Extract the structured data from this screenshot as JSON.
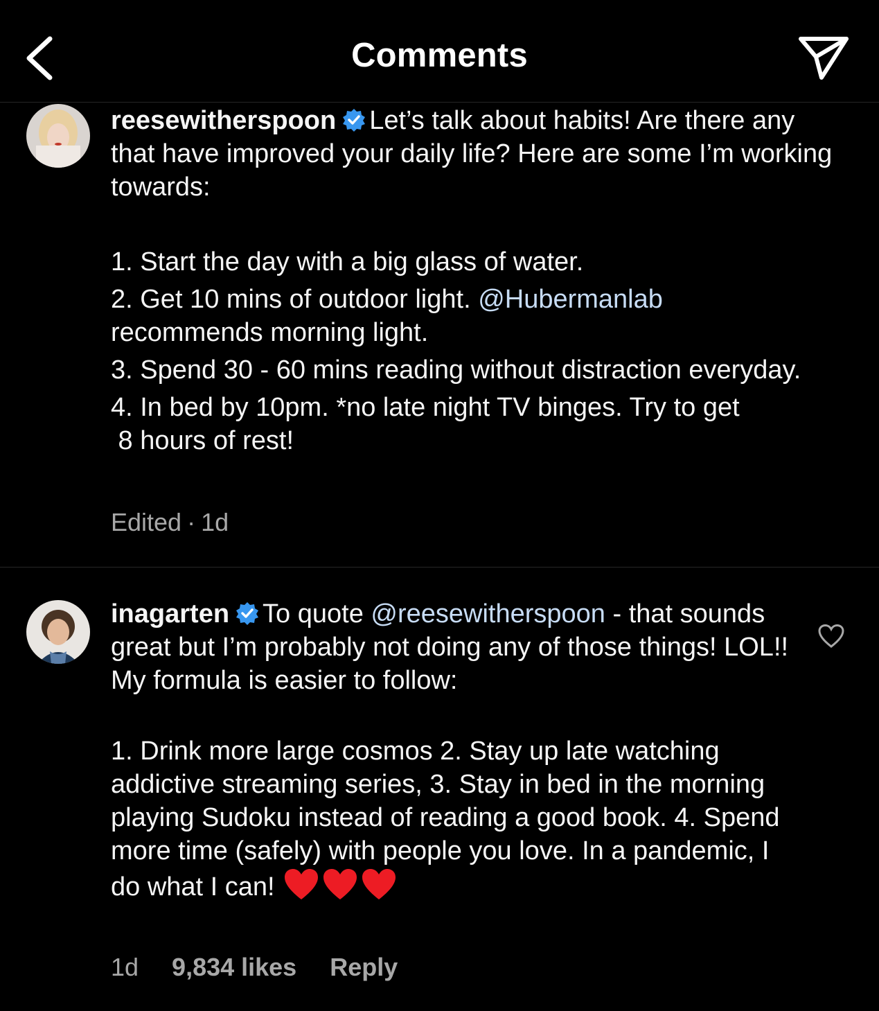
{
  "header": {
    "title": "Comments",
    "back_icon": "chevron-left-icon",
    "share_icon": "paper-plane-icon"
  },
  "comments": [
    {
      "username": "reesewitherspoon",
      "verified": true,
      "text_intro": "Let’s talk about habits! Are there any that have improved your daily life? Here are some I’m working towards:",
      "items": [
        "1. Start the day with a big glass of water.",
        "2. Get 10 mins of outdoor light.",
        "recommends morning light.",
        "3. Spend 30 - 60 mins reading without distraction everyday.",
        "4. In bed by 10pm. *no late night TV binges. Try to get",
        " 8 hours of rest!"
      ],
      "mention": "@Hubermanlab",
      "meta_edited": "Edited",
      "meta_time": "1d"
    },
    {
      "username": "inagarten",
      "verified": true,
      "mention": "@reesewitherspoon",
      "text_pre": "To quote",
      "text_after_mention": "- that sounds great but I’m probably not doing any of those things!  LOL!! My formula is easier to follow:",
      "text_list": "1. Drink more large cosmos  2.  Stay up late watching addictive streaming series,  3.  Stay in bed in the morning playing Sudoku instead of reading a good book.  4.  Spend more time (safely) with people you love.  In a pandemic, I do what I can!",
      "emoji_count": 3,
      "meta_time": "1d",
      "meta_likes": "9,834 likes",
      "meta_reply": "Reply",
      "like_icon": "heart-outline-icon"
    }
  ],
  "colors": {
    "background": "#000000",
    "text": "#f5f5f5",
    "muted": "#a8a8a8",
    "mention": "#c7dcf5",
    "verified": "#3897f0",
    "heart": "#ed1c24"
  }
}
